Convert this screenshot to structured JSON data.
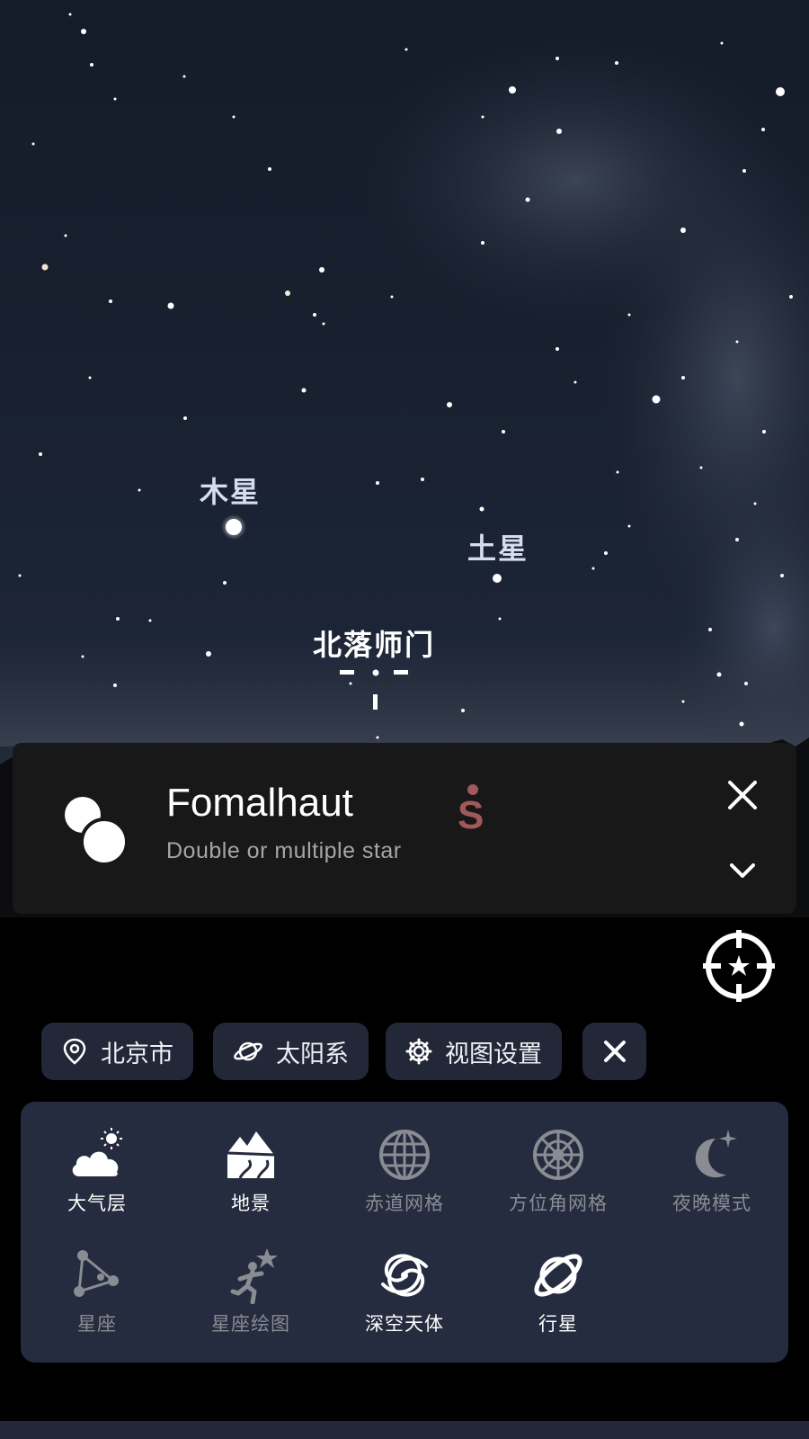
{
  "sky": {
    "labels": {
      "jupiter": "木星",
      "saturn": "土星",
      "target": "北落师门",
      "south": "S"
    }
  },
  "info_card": {
    "title": "Fomalhaut",
    "subtitle": "Double or multiple star",
    "icon": "double-star-icon"
  },
  "chips": [
    {
      "label": "北京市",
      "icon": "location-pin-icon"
    },
    {
      "label": "太阳系",
      "icon": "planet-icon"
    },
    {
      "label": "视图设置",
      "icon": "gear-icon"
    }
  ],
  "layers": [
    {
      "label": "大气层",
      "icon": "cloud-sun-icon",
      "active": true
    },
    {
      "label": "地景",
      "icon": "landscape-icon",
      "active": true
    },
    {
      "label": "赤道网格",
      "icon": "globe-grid-icon",
      "active": false
    },
    {
      "label": "方位角网格",
      "icon": "azimuth-grid-icon",
      "active": false
    },
    {
      "label": "夜晚模式",
      "icon": "moon-star-icon",
      "active": false
    },
    {
      "label": "星座",
      "icon": "constellation-icon",
      "active": false
    },
    {
      "label": "星座绘图",
      "icon": "constellation-art-icon",
      "active": false
    },
    {
      "label": "深空天体",
      "icon": "galaxy-icon",
      "active": true
    },
    {
      "label": "行星",
      "icon": "planet-ring-icon",
      "active": true
    }
  ],
  "colors": {
    "panel": "#262c3f",
    "chip": "#232838",
    "card": "#181818",
    "south_marker": "#a0585a"
  }
}
